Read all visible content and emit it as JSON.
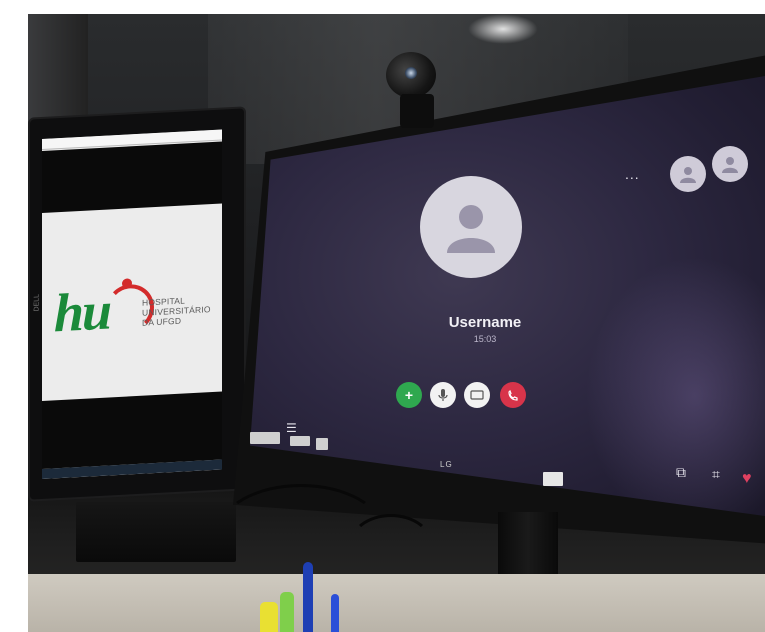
{
  "scene": {
    "description_colors": {
      "screen_bg": "#2d2841",
      "accept_green": "#2fa84f",
      "end_red": "#d8344a",
      "logo_green": "#1b8a3a",
      "logo_red": "#d32b2b"
    }
  },
  "left_monitor": {
    "logo_mark": "hu",
    "logo_lines": [
      "HOSPITAL",
      "UNIVERSITÁRIO",
      "DA UFGD"
    ],
    "side_label": "DELL"
  },
  "call_screen": {
    "username": "Username",
    "time": "15:03",
    "menu_dots": "...",
    "buttons": {
      "add": "+",
      "mic_icon": "microphone-icon",
      "video_icon": "video-camera-icon",
      "end_icon": "phone-hangup-icon"
    },
    "bottom_icons": [
      "window-icon",
      "focus-icon",
      "heart-icon"
    ]
  },
  "main_monitor": {
    "brand": "LG"
  }
}
